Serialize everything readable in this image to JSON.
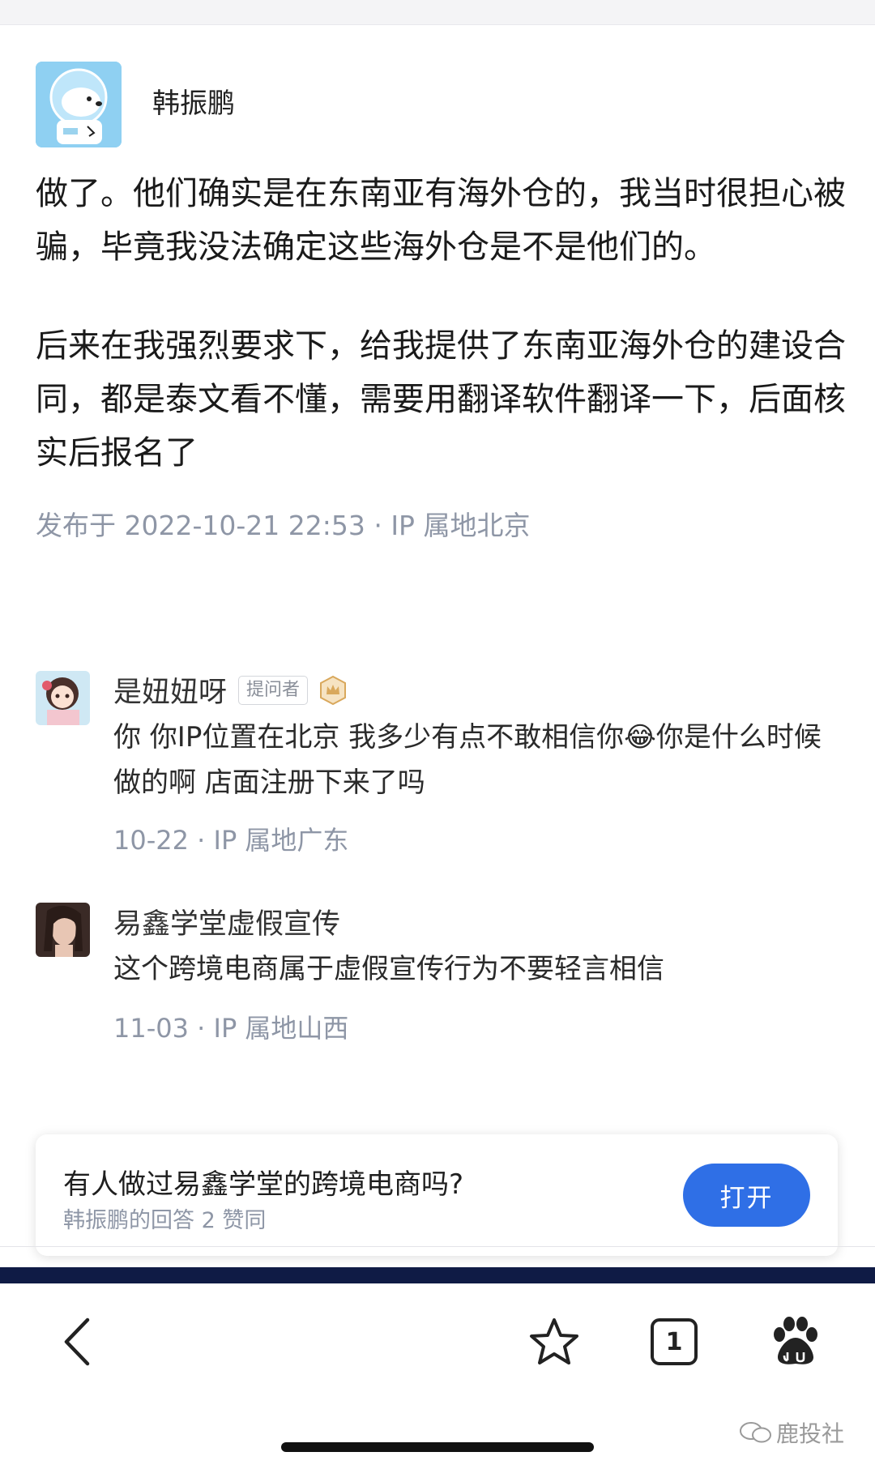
{
  "answer": {
    "author_name": "韩振鹏",
    "paragraph_1": "做了。他们确实是在东南亚有海外仓的，我当时很担心被骗，毕竟我没法确定这些海外仓是不是他们的。",
    "paragraph_2": "后来在我强烈要求下，给我提供了东南亚海外仓的建设合同，都是泰文看不懂，需要用翻译软件翻译一下，后面核实后报名了",
    "meta": "发布于 2022-10-21 22:53 · IP 属地北京"
  },
  "comments": [
    {
      "user": "是妞妞呀",
      "badge": "提问者",
      "text_before_emoji": "你 你IP位置在北京 我多少有点不敢相信你",
      "emoji": "😂",
      "text_after_emoji": "你是什么时候做的啊 店面注册下来了吗",
      "date": "10-22",
      "ip": "IP 属地广东"
    },
    {
      "user": "易鑫学堂虚假宣传",
      "text": "这个跨境电商属于虚假宣传行为不要轻言相信",
      "date": "11-03",
      "ip": "IP 属地山西"
    }
  ],
  "card": {
    "title": "有人做过易鑫学堂的跨境电商吗?",
    "subtitle": "韩振鹏的回答 2 赞同",
    "open_label": "打开"
  },
  "toolbar": {
    "tab_count": "1",
    "icons": [
      "back-icon",
      "star-icon",
      "tabs-icon",
      "baidu-icon"
    ]
  },
  "watermark": {
    "text": "鹿投社"
  },
  "colors": {
    "accent": "#2f6fe6",
    "meta": "#8e96a6",
    "band": "#0f1b45"
  }
}
